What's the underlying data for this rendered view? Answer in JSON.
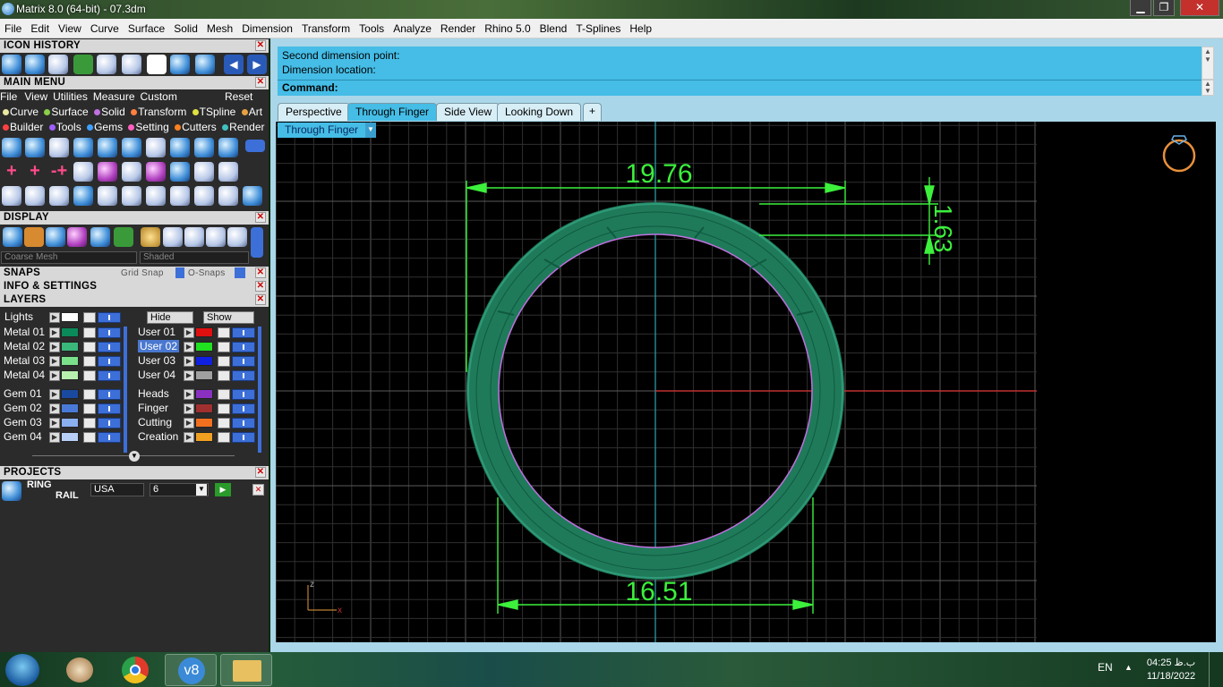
{
  "window": {
    "title": "Matrix 8.0 (64-bit) - 07.3dm",
    "minimize": "▁",
    "maximize": "❐",
    "close": "✕"
  },
  "menu": [
    "File",
    "Edit",
    "View",
    "Curve",
    "Surface",
    "Solid",
    "Mesh",
    "Dimension",
    "Transform",
    "Tools",
    "Analyze",
    "Render",
    "Rhino 5.0",
    "Blend",
    "T-Splines",
    "Help"
  ],
  "panels": {
    "icon_history": "ICON HISTORY",
    "main_menu": "MAIN MENU",
    "main_menu_items": [
      "File",
      "View",
      "Utilities",
      "Measure",
      "Custom"
    ],
    "reset": "Reset",
    "categories_row1": [
      {
        "label": "Curve",
        "color": "#e8e8a0"
      },
      {
        "label": "Surface",
        "color": "#8ad04a"
      },
      {
        "label": "Solid",
        "color": "#c070e0"
      },
      {
        "label": "Transform",
        "color": "#ff8040"
      },
      {
        "label": "TSpline",
        "color": "#e0e040"
      },
      {
        "label": "Art",
        "color": "#e8a040"
      }
    ],
    "categories_row2": [
      {
        "label": "Builder",
        "color": "#ff4040"
      },
      {
        "label": "Tools",
        "color": "#a060ff"
      },
      {
        "label": "Gems",
        "color": "#40a0ff"
      },
      {
        "label": "Setting",
        "color": "#ff60c0"
      },
      {
        "label": "Cutters",
        "color": "#ff8020"
      },
      {
        "label": "Render",
        "color": "#40c0c0"
      }
    ],
    "display": "DISPLAY",
    "display_mesh": "Coarse Mesh",
    "display_mode": "Shaded",
    "snaps": "SNAPS",
    "grid_snap": "Grid Snap",
    "osnaps": "O-Snaps",
    "info_settings": "INFO & SETTINGS",
    "layers": "LAYERS",
    "lights": "Lights",
    "hide": "Hide",
    "show": "Show",
    "layers_left": [
      {
        "name": "Metal 01",
        "color": "#0a8a5a"
      },
      {
        "name": "Metal 02",
        "color": "#3ab87a"
      },
      {
        "name": "Metal 03",
        "color": "#7ae08a"
      },
      {
        "name": "Metal 04",
        "color": "#b8f0b0"
      },
      {
        "name": "Gem 01",
        "color": "#1a4aa0"
      },
      {
        "name": "Gem 02",
        "color": "#4a7ad8"
      },
      {
        "name": "Gem 03",
        "color": "#8ab0f0"
      },
      {
        "name": "Gem 04",
        "color": "#b8d0f8"
      }
    ],
    "layers_right": [
      {
        "name": "User 01",
        "color": "#e01010"
      },
      {
        "name": "User 02",
        "color": "#20e020"
      },
      {
        "name": "User 03",
        "color": "#1020e0"
      },
      {
        "name": "User 04",
        "color": "#a0a0a0"
      },
      {
        "name": "Heads",
        "color": "#8a30c0"
      },
      {
        "name": "Finger",
        "color": "#a03030"
      },
      {
        "name": "Cutting",
        "color": "#f07020"
      },
      {
        "name": "Creation",
        "color": "#f0a020"
      }
    ],
    "projects": "PROJECTS",
    "project_name_1": "RING",
    "project_name_2": "RAIL",
    "project_standard": "USA",
    "project_size": "6"
  },
  "command": {
    "line1": "Second dimension point:",
    "line2": "Dimension location:",
    "prompt": "Command:"
  },
  "tabs": [
    "Perspective",
    "Through Finger",
    "Side View",
    "Looking Down",
    "+"
  ],
  "active_tab": "Through Finger",
  "viewport": {
    "label": "Through Finger",
    "dim_top": "19.76",
    "dim_bottom": "16.51",
    "dim_side": "1.63",
    "axis_z": "z",
    "axis_x": "x"
  },
  "taskbar": {
    "language": "EN",
    "time": "04:25 ب.ظ",
    "date": "11/18/2022"
  },
  "colors": {
    "ring": "#1f7a5a",
    "dimension": "#3cf03c",
    "grid": "#3a3a3a",
    "accent": "#45bde6"
  }
}
